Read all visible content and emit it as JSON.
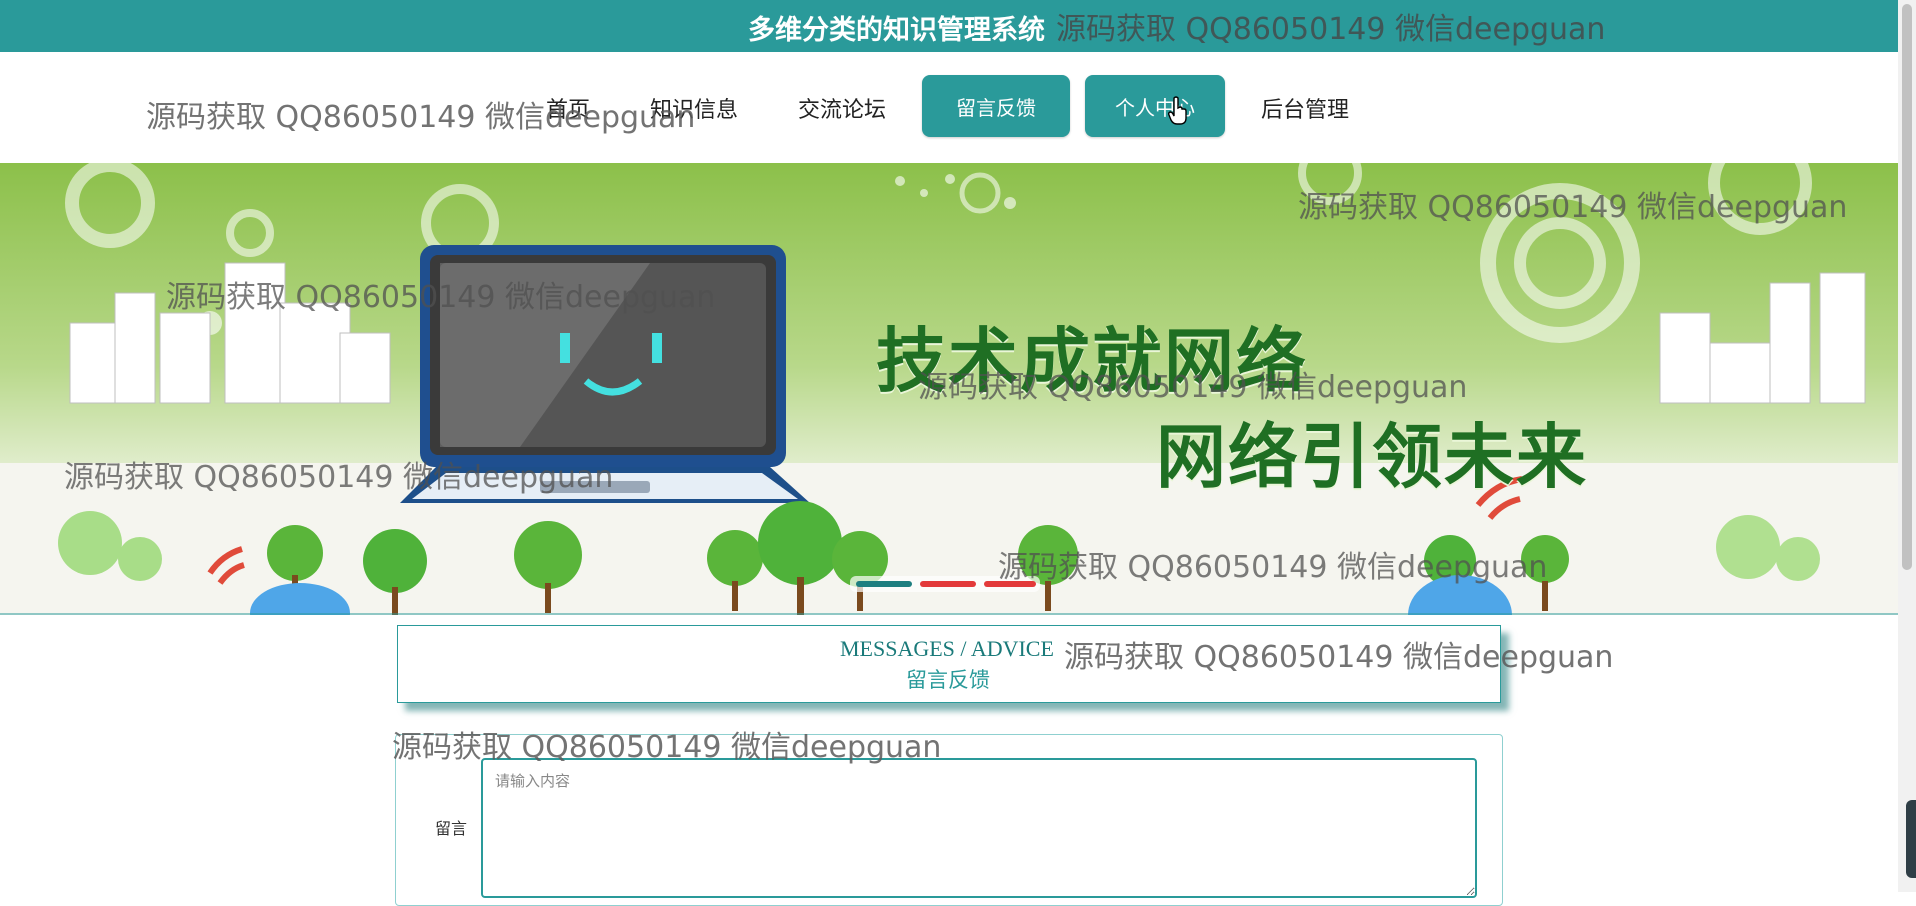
{
  "header": {
    "site_title": "多维分类的知识管理系统",
    "bg_color": "#2a9a9a"
  },
  "nav": {
    "items": [
      {
        "label": "首页"
      },
      {
        "label": "知识信息"
      },
      {
        "label": "交流论坛"
      },
      {
        "label": "留言反馈"
      },
      {
        "label": "个人中心"
      },
      {
        "label": "后台管理"
      }
    ]
  },
  "banner": {
    "slogan_line1": "技术成就网络",
    "slogan_line2": "网络引领未来",
    "carousel": {
      "active_index": 0,
      "count": 3
    }
  },
  "section": {
    "title_en": "MESSAGES / ADVICE",
    "title_cn": "留言反馈"
  },
  "form": {
    "message_label": "留言",
    "message_placeholder": "请输入内容",
    "message_value": ""
  },
  "watermark_text": "源码获取 QQ86050149 微信deepguan",
  "icons": {
    "cursor": "hand-pointer-icon"
  }
}
